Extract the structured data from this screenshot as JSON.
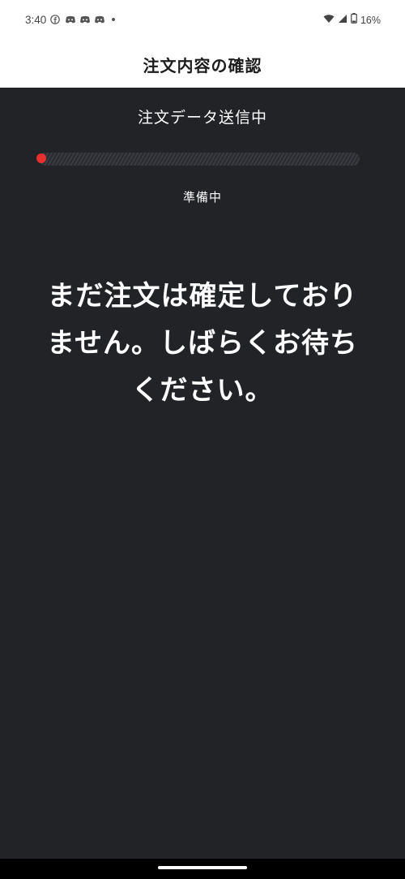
{
  "status_bar": {
    "time": "3:40",
    "battery": "16%",
    "icons": [
      "facebook-icon",
      "discord-icon",
      "discord-icon",
      "discord-icon",
      "dot-icon",
      "wifi-icon",
      "signal-icon",
      "battery-icon"
    ]
  },
  "app_bar": {
    "title": "注文内容の確認"
  },
  "progress": {
    "title": "注文データ送信中",
    "status": "準備中",
    "value": 0.0,
    "colors": {
      "indicator": "#e8312f",
      "track": "#3a3b40"
    }
  },
  "notice": {
    "message": "まだ注文は確定しておりません。しばらくお待ちください。"
  },
  "colors": {
    "background": "#222327",
    "app_bar": "#ffffff"
  }
}
